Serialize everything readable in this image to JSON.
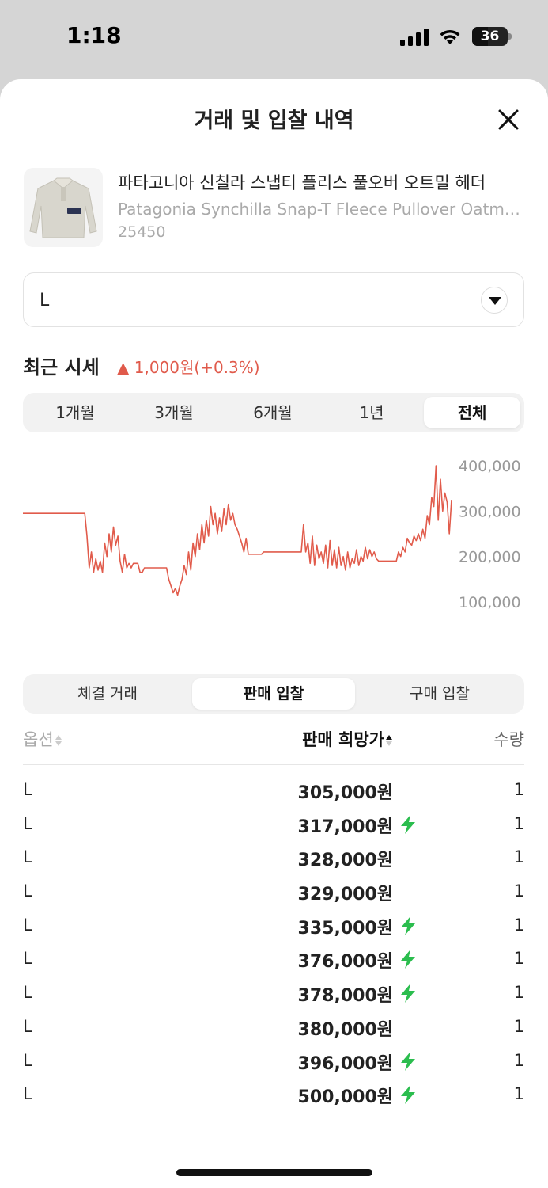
{
  "status_bar": {
    "time": "1:18",
    "battery": "36"
  },
  "sheet": {
    "title": "거래 및 입찰 내역"
  },
  "product": {
    "name_ko": "파타고니아 신칠라 스냅티 플리스 풀오버 오트밀 헤더",
    "name_en": "Patagonia Synchilla Snap-T Fleece Pullover Oatmeal Heather",
    "code": "25450"
  },
  "size_select": {
    "value": "L"
  },
  "recent_price": {
    "label": "최근 시세",
    "change": "▲ 1,000원(+0.3%)"
  },
  "period_tabs": [
    {
      "label": "1개월",
      "active": false
    },
    {
      "label": "3개월",
      "active": false
    },
    {
      "label": "6개월",
      "active": false
    },
    {
      "label": "1년",
      "active": false
    },
    {
      "label": "전체",
      "active": true
    }
  ],
  "chart_data": {
    "type": "line",
    "series": [
      {
        "values": [
          295000,
          295000,
          295000,
          295000,
          295000,
          295000,
          295000,
          295000,
          295000,
          295000,
          295000,
          295000,
          295000,
          295000,
          295000,
          295000,
          295000,
          295000,
          295000,
          295000,
          295000,
          295000,
          295000,
          295000,
          295000,
          295000,
          295000,
          295000,
          295000,
          245000,
          175000,
          210000,
          165000,
          195000,
          170000,
          190000,
          165000,
          230000,
          200000,
          250000,
          210000,
          265000,
          225000,
          245000,
          190000,
          165000,
          205000,
          175000,
          185000,
          175000,
          185000,
          185000,
          185000,
          165000,
          165000,
          175000,
          175000,
          175000,
          175000,
          175000,
          175000,
          175000,
          175000,
          175000,
          175000,
          175000,
          150000,
          135000,
          120000,
          130000,
          115000,
          135000,
          150000,
          180000,
          160000,
          210000,
          170000,
          230000,
          200000,
          250000,
          215000,
          270000,
          230000,
          280000,
          245000,
          310000,
          270000,
          295000,
          250000,
          285000,
          255000,
          305000,
          270000,
          315000,
          280000,
          295000,
          270000,
          260000,
          245000,
          230000,
          210000,
          240000,
          205000,
          205000,
          205000,
          205000,
          205000,
          205000,
          205000,
          210000,
          210000,
          210000,
          210000,
          210000,
          210000,
          210000,
          210000,
          210000,
          210000,
          210000,
          210000,
          210000,
          210000,
          210000,
          210000,
          210000,
          210000,
          270000,
          210000,
          230000,
          185000,
          245000,
          180000,
          225000,
          195000,
          210000,
          185000,
          225000,
          175000,
          235000,
          180000,
          215000,
          175000,
          220000,
          180000,
          200000,
          170000,
          210000,
          175000,
          195000,
          185000,
          215000,
          180000,
          200000,
          190000,
          220000,
          195000,
          215000,
          200000,
          210000,
          195000,
          190000,
          190000,
          190000,
          190000,
          190000,
          190000,
          190000,
          190000,
          190000,
          210000,
          200000,
          220000,
          210000,
          240000,
          230000,
          225000,
          245000,
          235000,
          250000,
          235000,
          260000,
          240000,
          290000,
          270000,
          330000,
          310000,
          400000,
          280000,
          370000,
          300000,
          340000,
          320000,
          250000,
          325000
        ]
      }
    ],
    "ylim": [
      100000,
      400000
    ],
    "yticks": [
      "400,000",
      "300,000",
      "200,000",
      "100,000"
    ],
    "line_color": "#e15b4b"
  },
  "trade_tabs": [
    {
      "label": "체결 거래",
      "active": false
    },
    {
      "label": "판매 입찰",
      "active": true
    },
    {
      "label": "구매 입찰",
      "active": false
    }
  ],
  "table": {
    "headers": {
      "option": "옵션",
      "price": "판매 희망가",
      "qty": "수량"
    },
    "rows": [
      {
        "option": "L",
        "price": "305,000원",
        "fast": false,
        "qty": "1"
      },
      {
        "option": "L",
        "price": "317,000원",
        "fast": true,
        "qty": "1"
      },
      {
        "option": "L",
        "price": "328,000원",
        "fast": false,
        "qty": "1"
      },
      {
        "option": "L",
        "price": "329,000원",
        "fast": false,
        "qty": "1"
      },
      {
        "option": "L",
        "price": "335,000원",
        "fast": true,
        "qty": "1"
      },
      {
        "option": "L",
        "price": "376,000원",
        "fast": true,
        "qty": "1"
      },
      {
        "option": "L",
        "price": "378,000원",
        "fast": true,
        "qty": "1"
      },
      {
        "option": "L",
        "price": "380,000원",
        "fast": false,
        "qty": "1"
      },
      {
        "option": "L",
        "price": "396,000원",
        "fast": true,
        "qty": "1"
      },
      {
        "option": "L",
        "price": "500,000원",
        "fast": true,
        "qty": "1"
      }
    ]
  }
}
